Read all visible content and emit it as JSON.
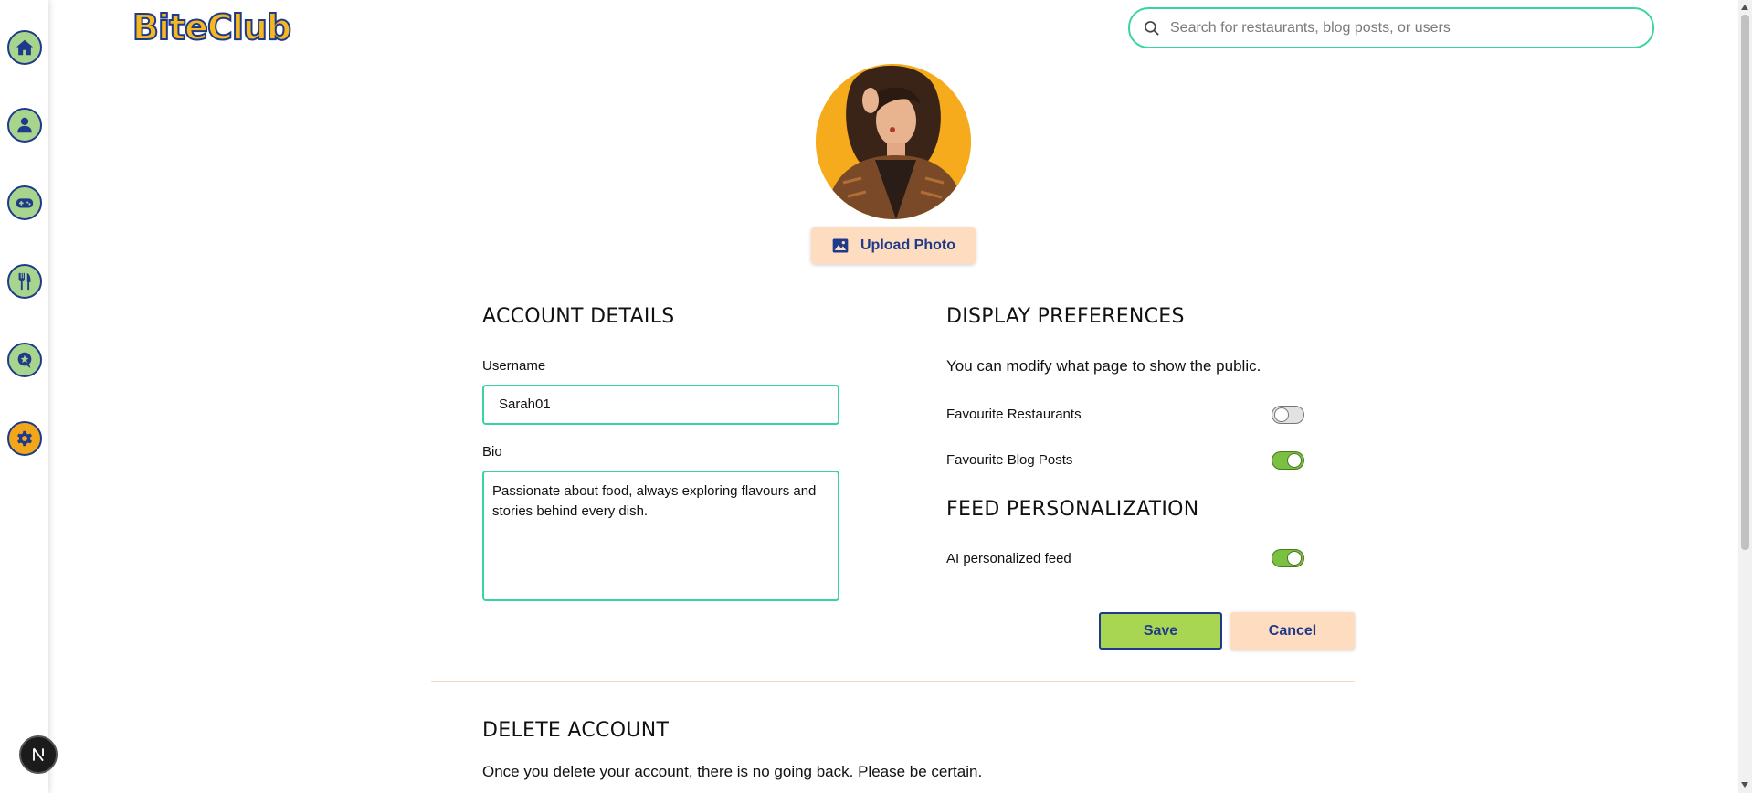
{
  "app": {
    "logo_text": "BiteClub"
  },
  "search": {
    "placeholder": "Search for restaurants, blog posts, or users"
  },
  "sidebar": {
    "items": [
      {
        "name": "home",
        "icon": "home-icon"
      },
      {
        "name": "profile",
        "icon": "user-icon"
      },
      {
        "name": "games",
        "icon": "gamepad-icon"
      },
      {
        "name": "restaurants",
        "icon": "utensils-icon"
      },
      {
        "name": "reviews",
        "icon": "star-chat-icon"
      },
      {
        "name": "settings",
        "icon": "gear-icon",
        "active": true
      }
    ]
  },
  "profile": {
    "upload_label": "Upload Photo"
  },
  "account": {
    "heading": "ACCOUNT DETAILS",
    "username_label": "Username",
    "username_value": "Sarah01",
    "bio_label": "Bio",
    "bio_value": "Passionate about food, always exploring flavours and stories behind every dish."
  },
  "display": {
    "heading": "DISPLAY PREFERENCES",
    "description": "You can modify what page to show the public.",
    "toggles": [
      {
        "label": "Favourite Restaurants",
        "on": false
      },
      {
        "label": "Favourite Blog Posts",
        "on": true
      }
    ]
  },
  "feed": {
    "heading": "FEED PERSONALIZATION",
    "toggles": [
      {
        "label": "AI personalized feed",
        "on": true
      }
    ]
  },
  "actions": {
    "save_label": "Save",
    "cancel_label": "Cancel"
  },
  "delete": {
    "heading": "DELETE ACCOUNT",
    "description": "Once you delete your account, there is no going back. Please be certain."
  },
  "colors": {
    "accent_teal": "#3ad3a6",
    "nav_green": "#a8d58e",
    "nav_active": "#f2a71b",
    "brand_navy": "#1f3a8a",
    "save_green": "#a8d552",
    "peach": "#fedcc0",
    "toggle_on": "#7cc043"
  }
}
